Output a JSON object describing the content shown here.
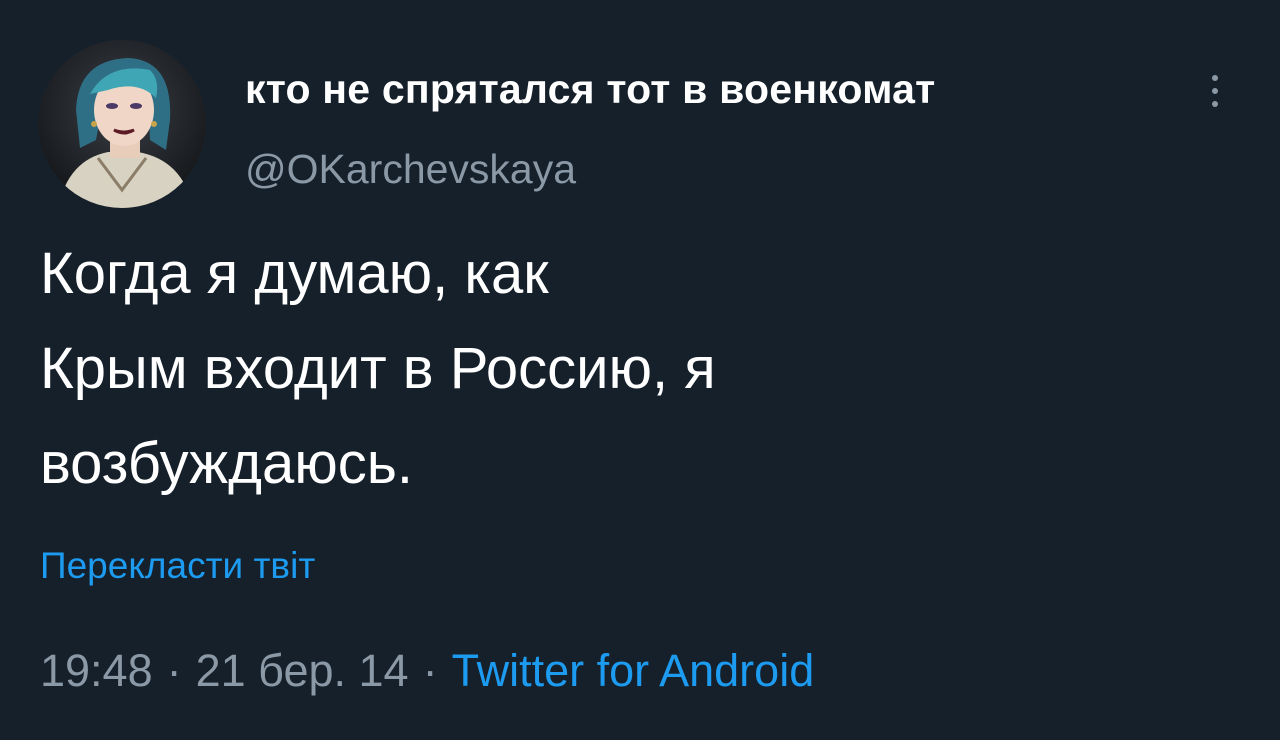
{
  "author": {
    "display_name": "кто не спрятался тот в военкомат",
    "handle": "@OKarchevskaya",
    "avatar_icon": "profile-photo"
  },
  "tweet": {
    "text_lines": [
      "Когда я думаю, как",
      "Крым входит в Россию, я",
      "возбуждаюсь."
    ],
    "translate_label": "Перекласти твіт",
    "time": "19:48",
    "date": "21 бер. 14",
    "separator": "·",
    "source": "Twitter for Android"
  },
  "icons": {
    "more": "more-vertical-icon"
  },
  "colors": {
    "background": "#15202b",
    "text": "#ffffff",
    "secondary": "#8b98a5",
    "accent": "#1d9bf0"
  }
}
